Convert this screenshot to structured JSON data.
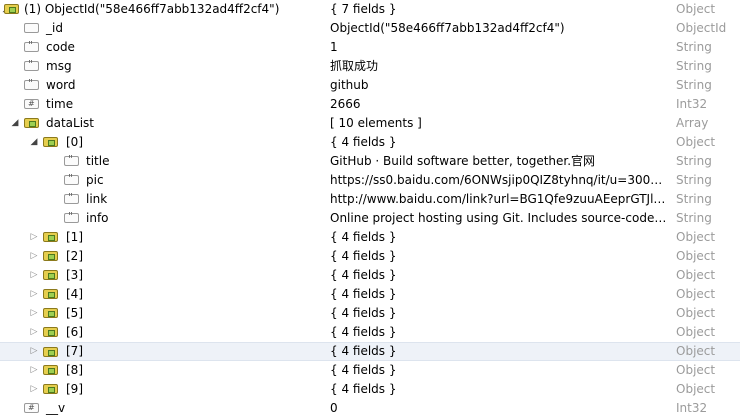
{
  "rows": [
    {
      "level": 0,
      "arrow": "open",
      "icon": "object",
      "key": "(1) ObjectId(\"58e466ff7abb132ad4ff2cf4\")",
      "value": "{ 7 fields }",
      "type": "Object"
    },
    {
      "level": 1,
      "arrow": "",
      "icon": "blank",
      "key": "_id",
      "value": "ObjectId(\"58e466ff7abb132ad4ff2cf4\")",
      "type": "ObjectId"
    },
    {
      "level": 1,
      "arrow": "",
      "icon": "string",
      "key": "code",
      "value": "1",
      "type": "String"
    },
    {
      "level": 1,
      "arrow": "",
      "icon": "string",
      "key": "msg",
      "value": "抓取成功",
      "type": "String"
    },
    {
      "level": 1,
      "arrow": "",
      "icon": "string",
      "key": "word",
      "value": "github",
      "type": "String"
    },
    {
      "level": 1,
      "arrow": "",
      "icon": "int",
      "key": "time",
      "value": "2666",
      "type": "Int32"
    },
    {
      "level": 1,
      "arrow": "open",
      "icon": "object",
      "key": "dataList",
      "value": "[ 10 elements ]",
      "type": "Array"
    },
    {
      "level": 2,
      "arrow": "open",
      "icon": "object",
      "key": "[0]",
      "value": "{ 4 fields }",
      "type": "Object"
    },
    {
      "level": 3,
      "arrow": "",
      "icon": "string",
      "key": "title",
      "value": "GitHub · Build software better, together.官网",
      "type": "String"
    },
    {
      "level": 3,
      "arrow": "",
      "icon": "string",
      "key": "pic",
      "value": "https://ss0.baidu.com/6ONWsjip0QIZ8tyhnq/it/u=30013...",
      "type": "String"
    },
    {
      "level": 3,
      "arrow": "",
      "icon": "string",
      "key": "link",
      "value": "http://www.baidu.com/link?url=BG1Qfe9zuuAEeprGTJlo0...",
      "type": "String"
    },
    {
      "level": 3,
      "arrow": "",
      "icon": "string",
      "key": "info",
      "value": "Online project hosting using Git. Includes source-code b...",
      "type": "String"
    },
    {
      "level": 2,
      "arrow": "closed",
      "icon": "object",
      "key": "[1]",
      "value": "{ 4 fields }",
      "type": "Object"
    },
    {
      "level": 2,
      "arrow": "closed",
      "icon": "object",
      "key": "[2]",
      "value": "{ 4 fields }",
      "type": "Object"
    },
    {
      "level": 2,
      "arrow": "closed",
      "icon": "object",
      "key": "[3]",
      "value": "{ 4 fields }",
      "type": "Object"
    },
    {
      "level": 2,
      "arrow": "closed",
      "icon": "object",
      "key": "[4]",
      "value": "{ 4 fields }",
      "type": "Object"
    },
    {
      "level": 2,
      "arrow": "closed",
      "icon": "object",
      "key": "[5]",
      "value": "{ 4 fields }",
      "type": "Object"
    },
    {
      "level": 2,
      "arrow": "closed",
      "icon": "object",
      "key": "[6]",
      "value": "{ 4 fields }",
      "type": "Object"
    },
    {
      "level": 2,
      "arrow": "closed",
      "icon": "object",
      "key": "[7]",
      "value": "{ 4 fields }",
      "type": "Object",
      "selected": true
    },
    {
      "level": 2,
      "arrow": "closed",
      "icon": "object",
      "key": "[8]",
      "value": "{ 4 fields }",
      "type": "Object"
    },
    {
      "level": 2,
      "arrow": "closed",
      "icon": "object",
      "key": "[9]",
      "value": "{ 4 fields }",
      "type": "Object"
    },
    {
      "level": 1,
      "arrow": "",
      "icon": "int",
      "key": "__v",
      "value": "0",
      "type": "Int32"
    }
  ]
}
